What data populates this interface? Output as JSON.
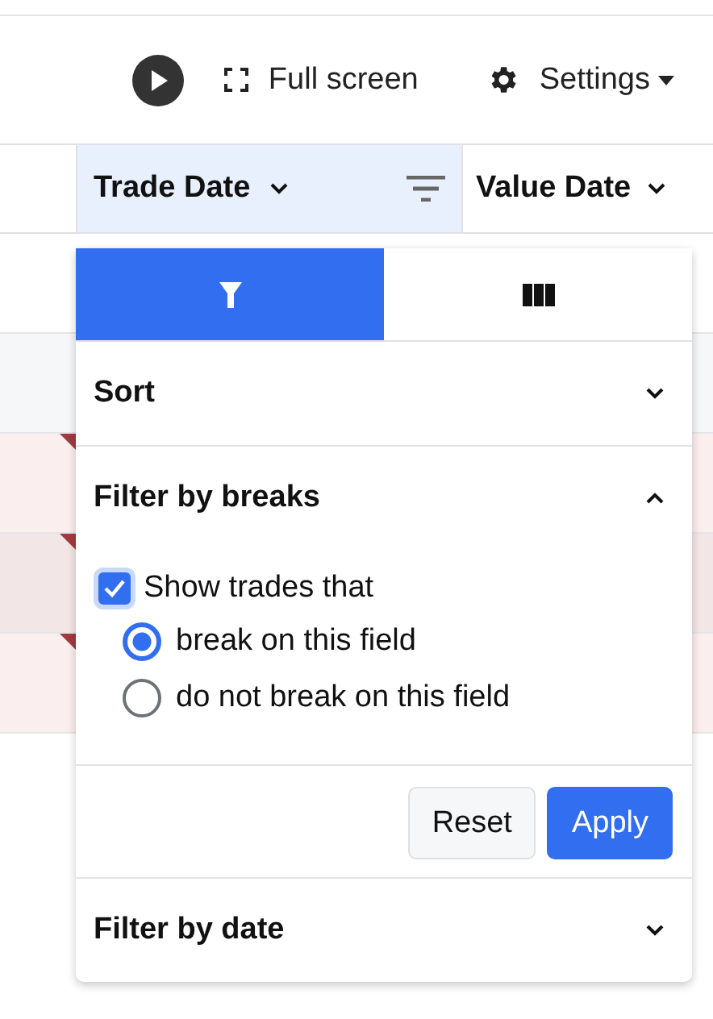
{
  "toolbar": {
    "play": {
      "kind": "play"
    },
    "fullscreen": {
      "label": "Full screen"
    },
    "settings": {
      "label": "Settings"
    }
  },
  "columns": [
    {
      "label": "Trade Date",
      "filtered": true
    },
    {
      "label": "Value Date",
      "filtered": false
    }
  ],
  "rows": [
    {
      "break": false
    },
    {
      "break": false
    },
    {
      "break": true
    },
    {
      "break": true
    },
    {
      "break": true
    }
  ],
  "popup": {
    "tabs": [
      {
        "kind": "filter",
        "selected": true
      },
      {
        "kind": "columns",
        "selected": false
      }
    ],
    "sections": [
      {
        "title": "Sort",
        "expanded": false
      },
      {
        "title": "Filter by breaks",
        "expanded": true,
        "checkbox": {
          "label": "Show trades that",
          "checked": true
        },
        "options": [
          {
            "label": "break on this field",
            "selected": true
          },
          {
            "label": "do not break on this field",
            "selected": false
          }
        ],
        "buttons": [
          {
            "label": "Reset",
            "kind": "secondary"
          },
          {
            "label": "Apply",
            "kind": "primary"
          }
        ]
      },
      {
        "title": "Filter by date",
        "expanded": false
      }
    ]
  }
}
